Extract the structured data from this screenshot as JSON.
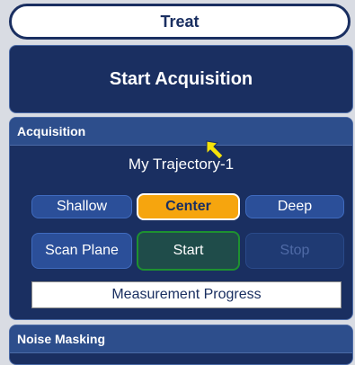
{
  "treat": {
    "label": "Treat"
  },
  "start_acquisition": {
    "label": "Start Acquisition"
  },
  "acquisition": {
    "header": "Acquisition",
    "trajectory": "My Trajectory-1",
    "depth_buttons": {
      "shallow": "Shallow",
      "center": "Center",
      "deep": "Deep"
    },
    "scan_plane": "Scan Plane",
    "start": "Start",
    "stop": "Stop",
    "progress_label": "Measurement Progress"
  },
  "noise_masking": {
    "header": "Noise Masking"
  },
  "colors": {
    "panel_navy": "#1a2f61",
    "header_blue": "#2d4e8c",
    "selected_orange": "#f6a50e",
    "start_green_border": "#1e9130",
    "cursor_yellow": "#f5e20a"
  },
  "icons": {
    "cursor": "mouse-pointer-icon"
  }
}
